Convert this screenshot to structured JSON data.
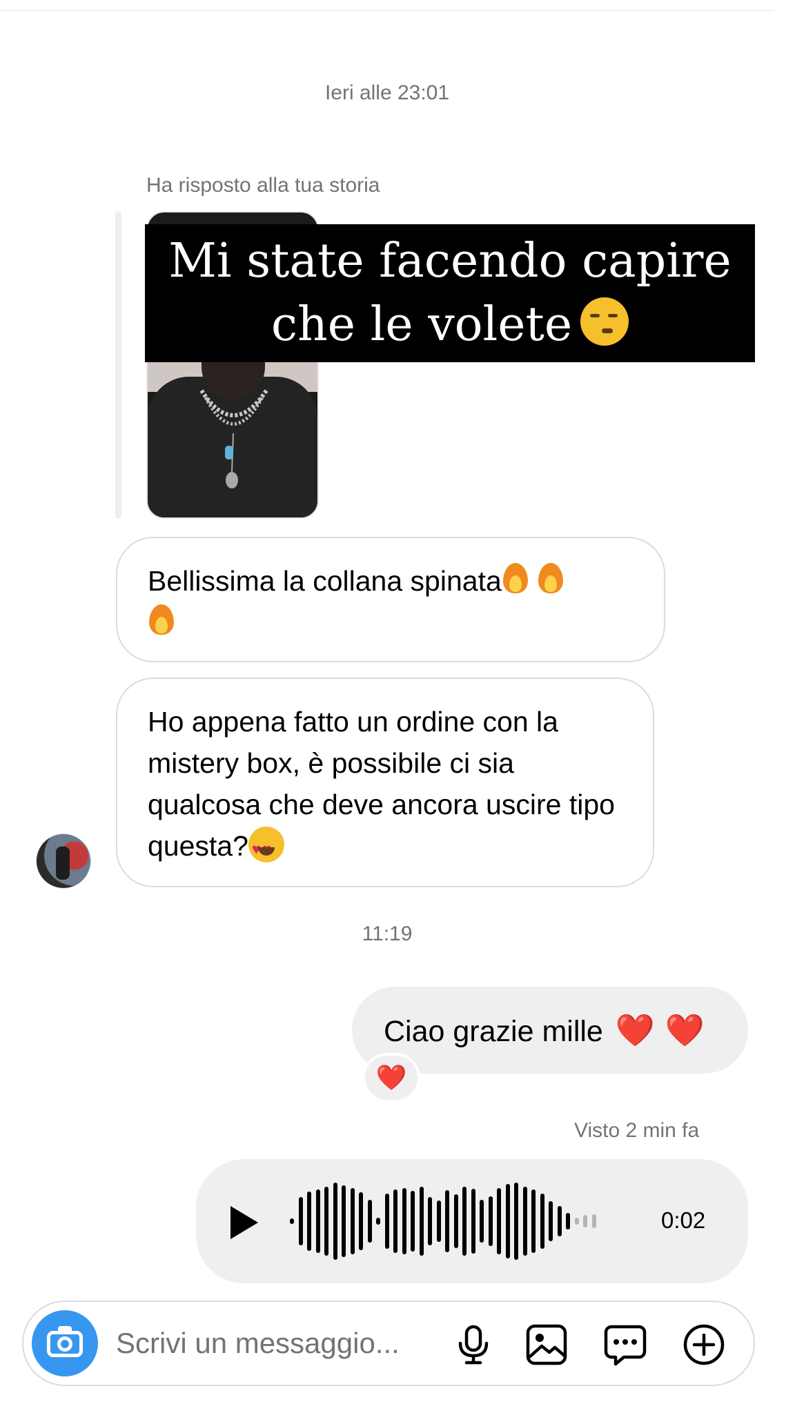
{
  "thread": {
    "timestamp_1": "Ieri alle 23:01",
    "story_reply_label": "Ha risposto alla tua storia",
    "story_text_line_1": "Mi state facendo capire",
    "story_text_line_2": "che le volete",
    "timestamp_2": "11:19",
    "seen_status": "Visto 2 min fa"
  },
  "messages": {
    "incoming_1": "Bellissima la collana spinata",
    "incoming_2": "Ho appena fatto un ordine con la mistery box, è possibile ci sia qualcosa che deve ancora uscire tipo questa?",
    "outgoing_1": "Ciao grazie mille",
    "outgoing_1_hearts": "❤️ ❤️",
    "reaction": "❤️"
  },
  "voice_message": {
    "duration": "0:02",
    "played_fraction": 0.9
  },
  "composer": {
    "placeholder": "Scrivi un messaggio..."
  },
  "icons": [
    "camera-icon",
    "microphone-icon",
    "gallery-icon",
    "sticker-icon",
    "plus-icon",
    "play-icon"
  ],
  "colors": {
    "accent": "#3797f0",
    "outgoing_bubble": "#efefef",
    "muted_text": "#737373",
    "heart": "#e3242b"
  }
}
